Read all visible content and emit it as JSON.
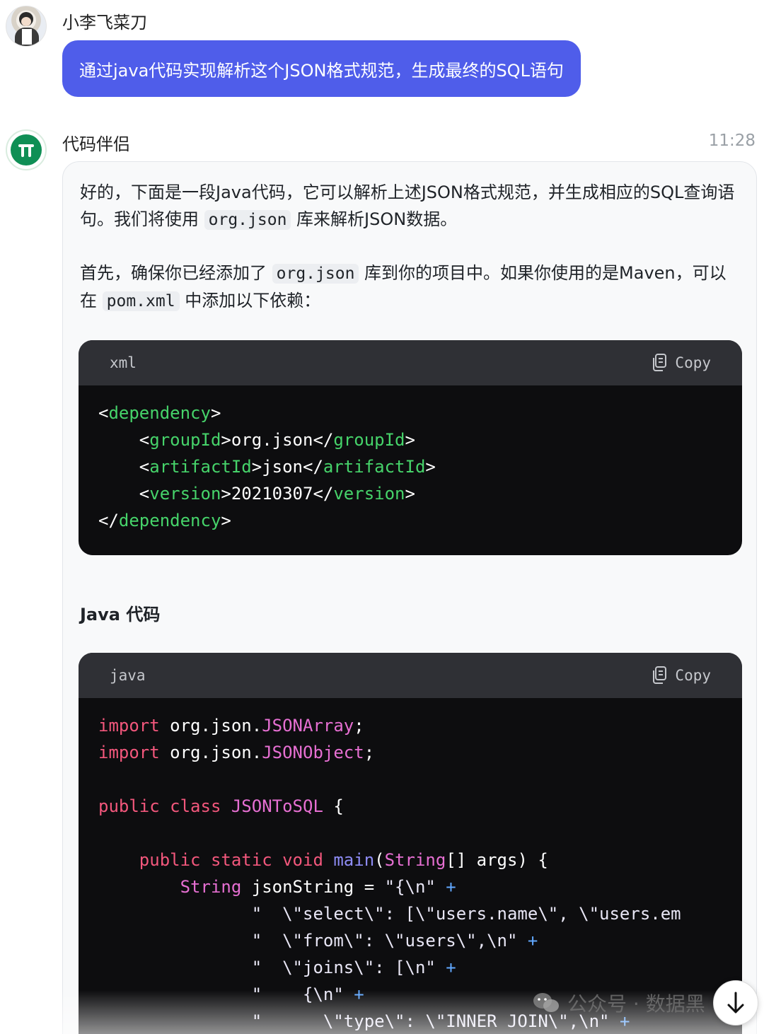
{
  "user": {
    "name": "小李飞菜刀",
    "message": "通过java代码实现解析这个JSON格式规范，生成最终的SQL语句"
  },
  "bot": {
    "name": "代码伴侣",
    "time": "11:28",
    "para1": {
      "a": "好的，下面是一段Java代码，它可以解析上述JSON格式规范，并生成相应的SQL查询语句。我们将使用 ",
      "code": "org.json",
      "b": " 库来解析JSON数据。"
    },
    "para2": {
      "a": "首先，确保你已经添加了 ",
      "code1": "org.json",
      "b": " 库到你的项目中。如果你使用的是Maven，可以在 ",
      "code2": "pom.xml",
      "c": " 中添加以下依赖："
    },
    "section_title": "Java 代码",
    "copy_label": "Copy",
    "xml_block": {
      "lang": "xml",
      "lines": [
        "<dependency>",
        "    <groupId>org.json</groupId>",
        "    <artifactId>json</artifactId>",
        "    <version>20210307</version>",
        "</dependency>"
      ]
    },
    "java_block": {
      "lang": "java",
      "lines": [
        "import org.json.JSONArray;",
        "import org.json.JSONObject;",
        "",
        "public class JSONToSQL {",
        "",
        "    public static void main(String[] args) {",
        "        String jsonString = \"{\\n\" +",
        "               \"  \\\"select\\\": [\\\"users.name\\\", \\\"users.em",
        "               \"  \\\"from\\\": \\\"users\\\",\\n\" +",
        "               \"  \\\"joins\\\": [\\n\" +",
        "               \"    {\\n\" +",
        "               \"      \\\"type\\\": \\\"INNER JOIN\\\",\\n\" +"
      ]
    }
  },
  "watermark": "公众号 · 数据黑",
  "icons": {
    "copy": "copy-icon",
    "scroll_down": "arrow-down-icon",
    "wechat": "wechat-icon"
  },
  "colors": {
    "bubble": "#4f5dea",
    "code_bg": "#0d0d0f",
    "code_header": "#2f3035",
    "xml_tag": "#46d36a",
    "keyword": "#f2577c"
  }
}
